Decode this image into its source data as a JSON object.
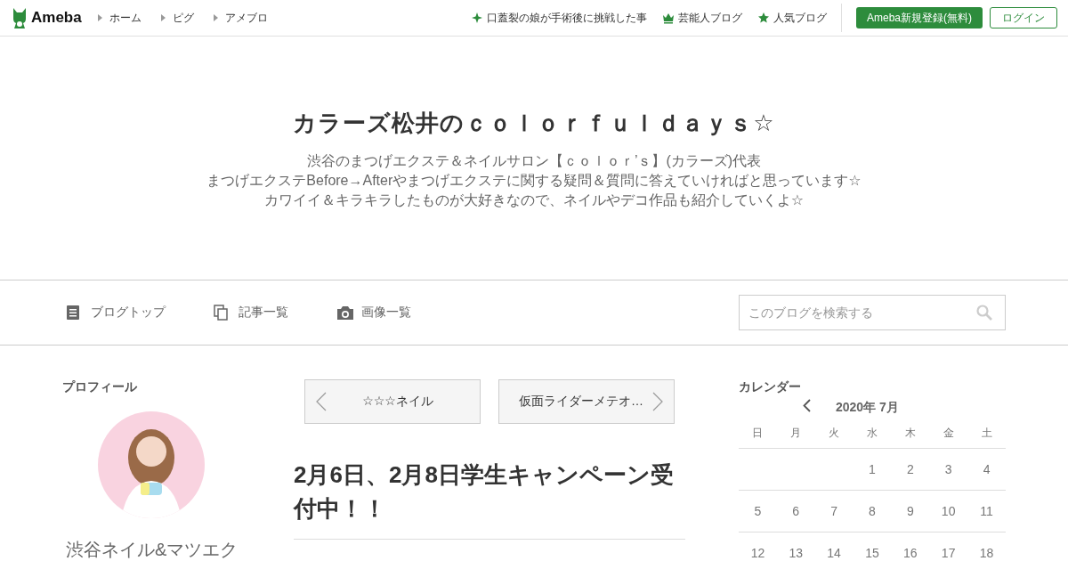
{
  "header": {
    "logo": "Ameba",
    "links": [
      {
        "label": "ホーム"
      },
      {
        "label": "ピグ"
      },
      {
        "label": "アメブロ"
      }
    ],
    "features": [
      {
        "kind": "sparkle",
        "label": "口蓋裂の娘が手術後に挑戦した事"
      },
      {
        "kind": "crown",
        "label": "芸能人ブログ"
      },
      {
        "kind": "star",
        "label": "人気ブログ"
      }
    ],
    "register": "Ameba新規登録(無料)",
    "login": "ログイン"
  },
  "blog": {
    "title": "カラーズ松井のｃｏｌｏｒｆｕｌｄａｙｓ☆",
    "description": [
      "渋谷のまつげエクステ＆ネイルサロン【ｃｏｌｏｒ’ｓ】(カラーズ)代表",
      "まつげエクステBefore→Afterやまつげエクステに関する疑問＆質問に答えていければと思っています☆",
      "カワイイ＆キラキラしたものが大好きなので、ネイルやデコ作品も紹介していくよ☆"
    ]
  },
  "nav": {
    "items": [
      {
        "kind": "top",
        "label": "ブログトップ"
      },
      {
        "kind": "list",
        "label": "記事一覧"
      },
      {
        "kind": "images",
        "label": "画像一覧"
      }
    ],
    "search": {
      "placeholder": "このブログを検索する"
    }
  },
  "profile": {
    "heading": "プロフィール",
    "name": "渋谷ネイル&マツエク"
  },
  "article": {
    "prev": "☆☆☆ネイル",
    "next": "仮面ライダーメテオ…",
    "title": "2月6日、2月8日学生キャンペーン受付中！！"
  },
  "calendar": {
    "heading": "カレンダー",
    "month": "2020年 7月",
    "weekdays": [
      "日",
      "月",
      "火",
      "水",
      "木",
      "金",
      "土"
    ],
    "weeks": [
      [
        "1",
        "2",
        "3",
        "4"
      ],
      [
        "5",
        "6",
        "7",
        "8",
        "9",
        "10",
        "11"
      ],
      [
        "12",
        "13",
        "14",
        "15",
        "16",
        "17",
        "18"
      ]
    ]
  }
}
